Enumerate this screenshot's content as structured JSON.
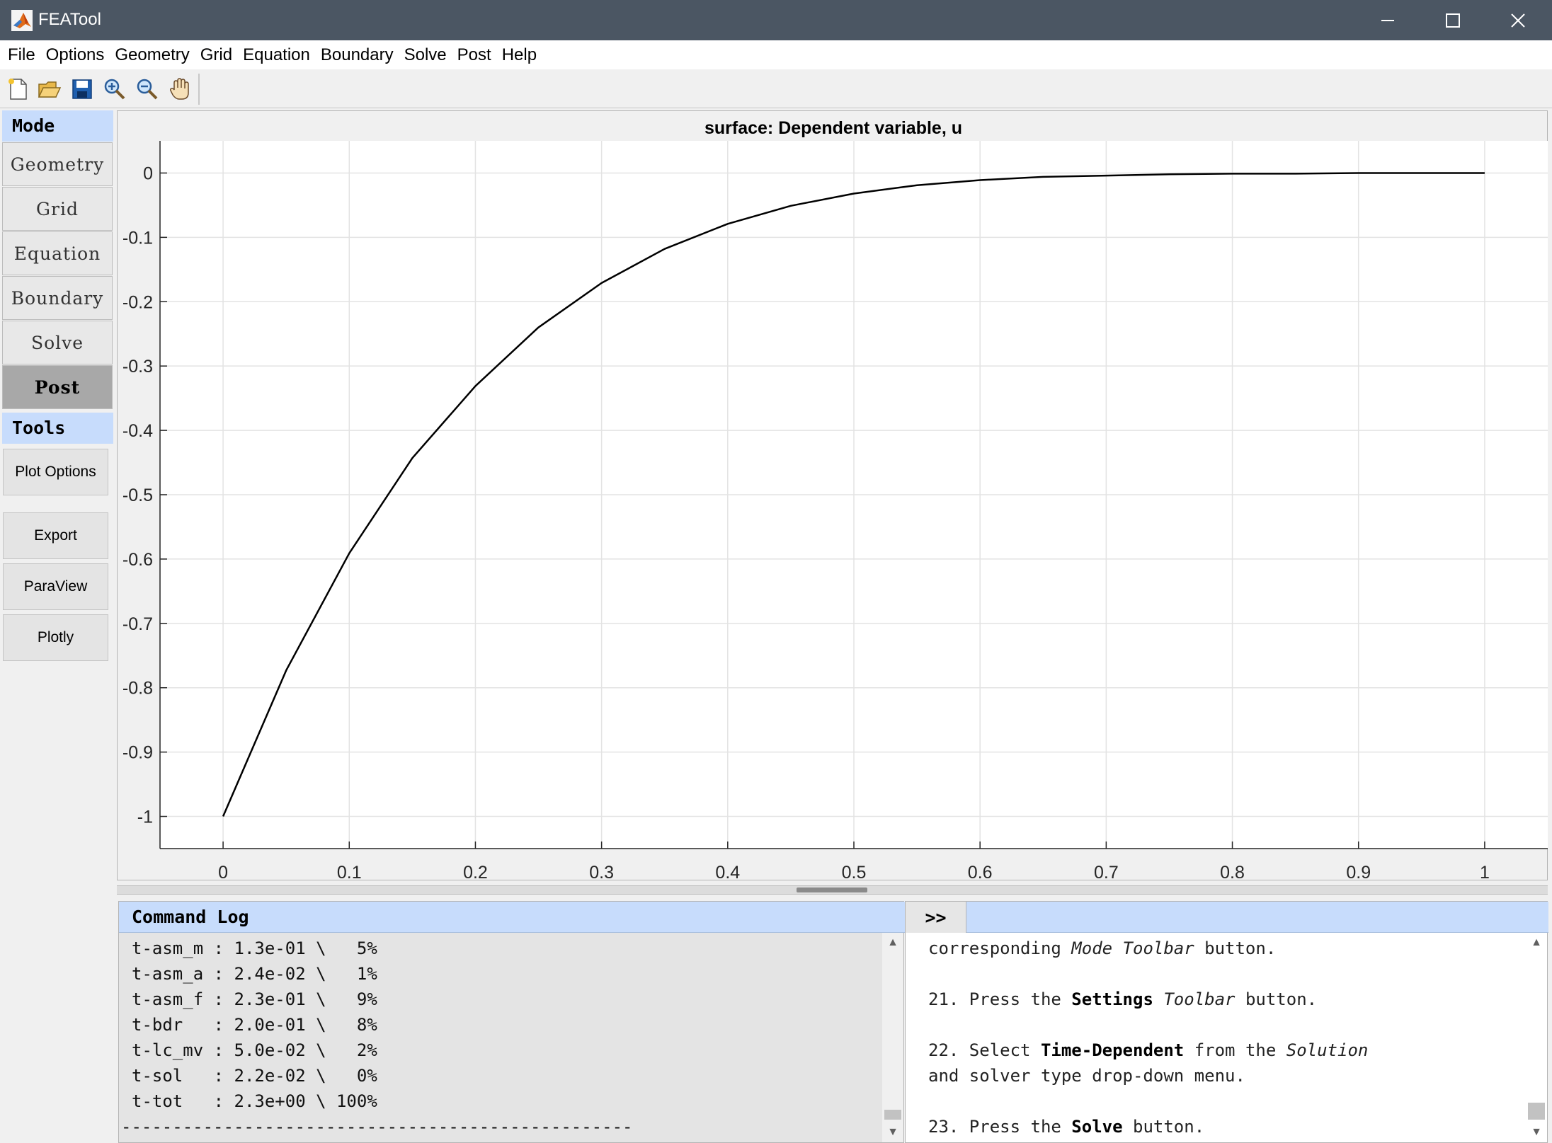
{
  "window": {
    "title": "FEATool",
    "controls": [
      "minimize",
      "maximize",
      "close"
    ]
  },
  "menu": [
    "File",
    "Options",
    "Geometry",
    "Grid",
    "Equation",
    "Boundary",
    "Solve",
    "Post",
    "Help"
  ],
  "toolbar": {
    "icons": [
      "new-file-icon",
      "open-folder-icon",
      "save-icon",
      "zoom-in-icon",
      "zoom-out-icon",
      "pan-hand-icon"
    ]
  },
  "sidebar": {
    "mode_header": "Mode",
    "modes": [
      {
        "label": "Geometry",
        "active": false
      },
      {
        "label": "Grid",
        "active": false
      },
      {
        "label": "Equation",
        "active": false
      },
      {
        "label": "Boundary",
        "active": false
      },
      {
        "label": "Solve",
        "active": false
      },
      {
        "label": "Post",
        "active": true
      }
    ],
    "tools_header": "Tools",
    "tools": [
      "Plot Options",
      "Export",
      "ParaView",
      "Plotly"
    ]
  },
  "chart_data": {
    "type": "line",
    "title": "surface: Dependent variable, u",
    "xlabel": "",
    "ylabel": "",
    "xlim": [
      -0.05,
      1.05
    ],
    "ylim": [
      -1.05,
      0.05
    ],
    "grid": true,
    "x_ticks": [
      "0",
      "0.1",
      "0.2",
      "0.3",
      "0.4",
      "0.5",
      "0.6",
      "0.7",
      "0.8",
      "0.9",
      "1"
    ],
    "y_ticks": [
      "0",
      "-0.1",
      "-0.2",
      "-0.3",
      "-0.4",
      "-0.5",
      "-0.6",
      "-0.7",
      "-0.8",
      "-0.9",
      "-1"
    ],
    "series": [
      {
        "color": "#000000",
        "x": [
          0,
          0.05,
          0.1,
          0.15,
          0.2,
          0.25,
          0.3,
          0.35,
          0.4,
          0.45,
          0.5,
          0.55,
          0.6,
          0.65,
          0.7,
          0.75,
          0.8,
          0.85,
          0.9,
          0.95,
          1
        ],
        "y": [
          -1,
          -0.773,
          -0.591,
          -0.443,
          -0.331,
          -0.24,
          -0.171,
          -0.118,
          -0.079,
          -0.051,
          -0.032,
          -0.019,
          -0.011,
          -0.006,
          -0.004,
          -0.002,
          -0.001,
          -0.001,
          0,
          0,
          0
        ]
      }
    ]
  },
  "command_log": {
    "header": "Command Log",
    "lines": [
      "t-asm_m : 1.3e-01 \\   5%",
      "t-asm_a : 2.4e-02 \\   1%",
      "t-asm_f : 2.3e-01 \\   9%",
      "t-bdr   : 2.0e-01 \\   8%",
      "t-lc_mv : 5.0e-02 \\   2%",
      "t-sol   : 2.2e-02 \\   0%",
      "t-tot   : 2.3e+00 \\ 100%"
    ],
    "rule": "--------------------------------------------------"
  },
  "tutorial": {
    "expand_label": ">>",
    "line1": {
      "a": "corresponding ",
      "b_i": "Mode Toolbar",
      "c": " button."
    },
    "line2": {
      "a": "21. Press the ",
      "b_b": "Settings",
      "c": " ",
      "d_i": "Toolbar",
      "e": " button."
    },
    "line3": {
      "a": "22. Select ",
      "b_b": "Time-Dependent",
      "c": " from the ",
      "d_i": "Solution"
    },
    "line4": {
      "a": "and solver type drop-down menu."
    },
    "line5": {
      "a": "23. Press the ",
      "b_b": "Solve",
      "c": " button."
    }
  }
}
